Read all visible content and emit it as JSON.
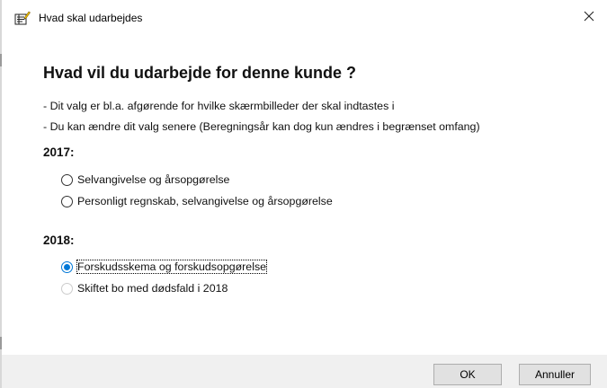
{
  "window": {
    "title": "Hvad skal udarbejdes",
    "close_glyph": "✕"
  },
  "dialog": {
    "heading": "Hvad vil du udarbejde for denne kunde ?",
    "info_lines": [
      "- Dit valg er bl.a. afgørende for hvilke skærmbilleder der skal indtastes i",
      "- Du kan ændre dit valg senere (Beregningsår kan dog kun ændres i begrænset omfang)"
    ],
    "groups": [
      {
        "year": "2017:",
        "options": [
          {
            "label": "Selvangivelse og årsopgørelse",
            "checked": false,
            "disabled": false
          },
          {
            "label": "Personligt regnskab, selvangivelse og årsopgørelse",
            "checked": false,
            "disabled": false
          }
        ]
      },
      {
        "year": "2018:",
        "options": [
          {
            "label": "Forskudsskema og forskudsopgørelse",
            "checked": true,
            "disabled": false
          },
          {
            "label": "Skiftet bo med dødsfald i 2018",
            "checked": false,
            "disabled": true
          }
        ]
      }
    ]
  },
  "footer": {
    "ok_label": "OK",
    "cancel_label": "Annuller"
  },
  "colors": {
    "accent": "#0078d7",
    "footer_bg": "#f0f0f0",
    "button_bg": "#e1e1e1"
  }
}
